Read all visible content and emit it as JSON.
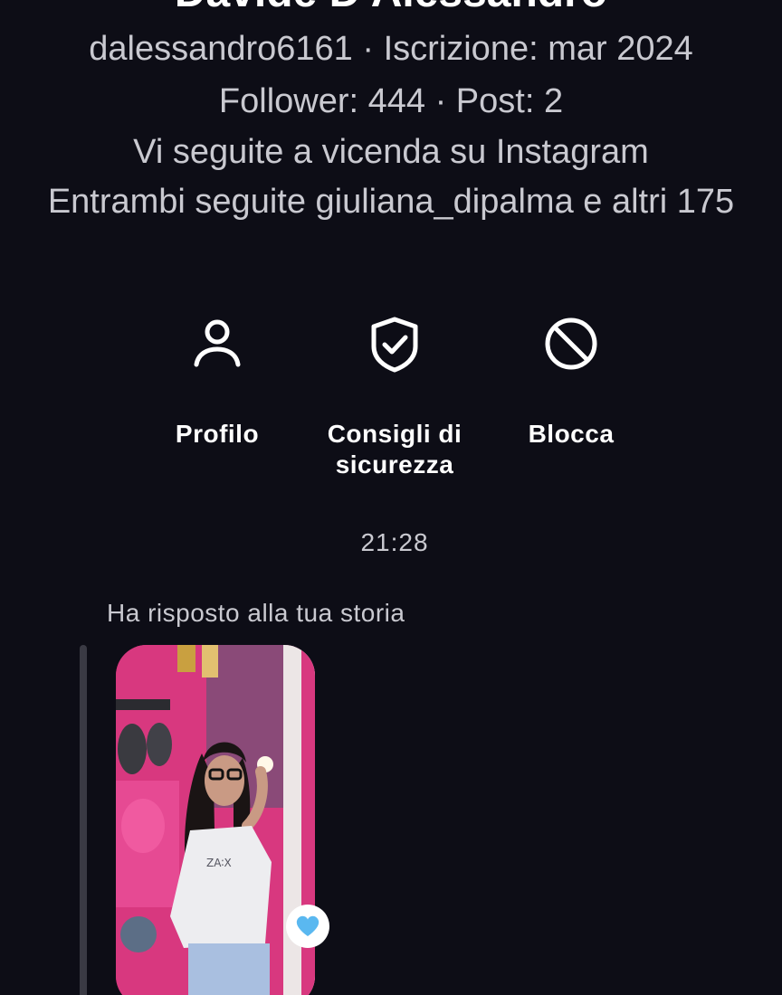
{
  "profile": {
    "display_name": "Davide D'Alessandro",
    "username_join": "dalessandro6161 · Iscrizione: mar 2024",
    "stats": "Follower: 444 · Post: 2",
    "mutual_follow": "Vi seguite a vicenda su Instagram",
    "mutual_friends": "Entrambi seguite giuliana_dipalma e altri 175"
  },
  "actions": [
    {
      "label": "Profilo",
      "icon": "person-icon"
    },
    {
      "label": "Consigli di sicurezza",
      "icon": "shield-check-icon"
    },
    {
      "label": "Blocca",
      "icon": "block-icon"
    }
  ],
  "conversation": {
    "timestamp": "21:28",
    "reply_context": "Ha risposto alla tua storia",
    "reaction_icon": "blue-heart-icon"
  },
  "colors": {
    "background": "#0d0d16",
    "secondary_text": "#c9c9d0",
    "story_pink": "#d6367f",
    "heart_blue": "#5ab8f0"
  }
}
